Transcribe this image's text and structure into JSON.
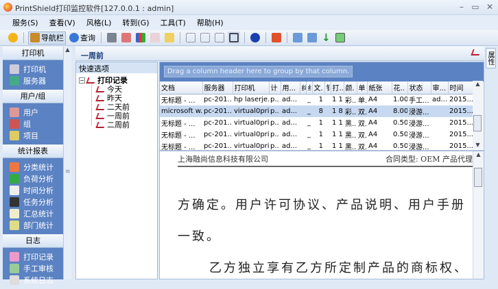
{
  "window": {
    "title": "PrintShield打印监控软件[127.0.0.1 : admin]"
  },
  "menu": [
    "服务(S)",
    "查看(V)",
    "风格(L)",
    "转到(G)",
    "工具(T)",
    "帮助(H)"
  ],
  "toolbar": {
    "nav": "导航栏",
    "query": "查询"
  },
  "sidebar": {
    "sections": [
      {
        "title": "打印机",
        "items": [
          "打印机",
          "服务器"
        ]
      },
      {
        "title": "用户/组",
        "items": [
          "用户",
          "组",
          "项目"
        ]
      },
      {
        "title": "统计报表",
        "items": [
          "分类统计",
          "负荷分析",
          "时间分析",
          "任务分析",
          "汇总统计",
          "部门统计"
        ]
      },
      {
        "title": "日志",
        "items": [
          "打印记录",
          "手工审核",
          "系统日志"
        ]
      }
    ]
  },
  "main": {
    "header": "一周前",
    "right_tab": "属性"
  },
  "tree": {
    "header": "快速选项",
    "root": "打印记录",
    "children": [
      "今天",
      "昨天",
      "二天前",
      "一周前",
      "二周前"
    ]
  },
  "grid": {
    "group_hint": "Drag a column header here to group by that column.",
    "columns": [
      "文档",
      "服务器",
      "打印机",
      "计",
      "用...",
      "纠",
      "纟",
      "文.",
      "钅",
      "打..",
      "颜.",
      "单",
      "紙张",
      "花..",
      "状态",
      "审...",
      "时间"
    ],
    "rows": [
      [
        "无标题 - ...",
        "pc-201...",
        "hp laserje...",
        "p..",
        "ad...",
        "",
        "_",
        "1",
        "",
        "1 1",
        "彩..",
        "单.",
        "A4",
        "1.00",
        "手工...",
        "ad...",
        "2015..."
      ],
      [
        "microsoft w...",
        "pc-201...",
        "virtual0pri...",
        "p..",
        "ad...",
        "",
        "_",
        "8",
        "",
        "1 8",
        "彩..",
        "双.",
        "A4",
        "8.00",
        "浸游...",
        "",
        "2015..."
      ],
      [
        "无标题 - ...",
        "pc-201...",
        "virtual0pri...",
        "p..",
        "ad...",
        "",
        "_",
        "1",
        "",
        "1 1",
        "黑..",
        "双.",
        "A4",
        "0.50",
        "浸游...",
        "",
        "2015..."
      ],
      [
        "无标题 - ...",
        "pc-201...",
        "virtual0pri...",
        "p..",
        "ad...",
        "",
        "_",
        "1",
        "",
        "1 1",
        "黑..",
        "双.",
        "A4",
        "0.50",
        "浸游...",
        "",
        "2015..."
      ],
      [
        "无标题 - ...",
        "pc-201...",
        "virtual0pri...",
        "p..",
        "ad...",
        "",
        "_",
        "1",
        "",
        "1 1",
        "黑..",
        "双.",
        "A4",
        "0.50",
        "浸游...",
        "",
        "2015..."
      ]
    ]
  },
  "document": {
    "header_left": "上海融尚信息科技有限公司",
    "header_right": "合同类型: OEM 产品代理",
    "lines": [
      "方确定。用户许可协议、产品说明、用户手册",
      "一致。",
      "乙方独立享有乙方所定制产品的商标权、"
    ]
  }
}
